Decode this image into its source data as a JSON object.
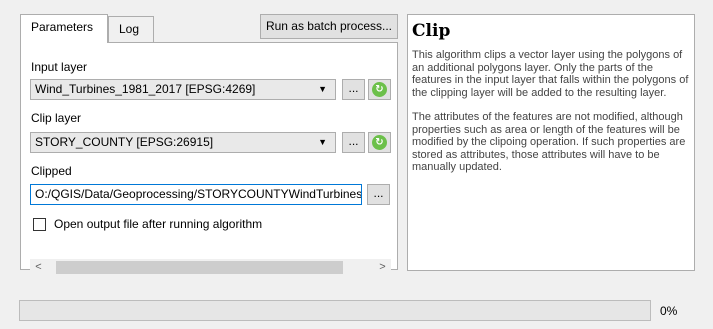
{
  "tabs": [
    {
      "label": "Parameters",
      "active": true
    },
    {
      "label": "Log",
      "active": false
    }
  ],
  "batch_button": "Run as batch process...",
  "params": {
    "input_layer": {
      "label": "Input layer",
      "value": "Wind_Turbines_1981_2017 [EPSG:4269]"
    },
    "clip_layer": {
      "label": "Clip layer",
      "value": "STORY_COUNTY [EPSG:26915]"
    },
    "clipped": {
      "label": "Clipped",
      "value": "O:/QGIS/Data/Geoprocessing/STORYCOUNTYWindTurbines.shp"
    },
    "open_output_label": "Open output file after running algorithm",
    "open_output_checked": false
  },
  "dots_label": "...",
  "help": {
    "title": "Clip",
    "para1": "This algorithm clips a vector layer using the polygons of an additional polygons layer. Only the parts of the features in the input layer that falls within the polygons of the clipping layer will be added to the resulting layer.",
    "para2": "The attributes of the features are not modified, although properties such as area or length of the features will be modified by the clipoing operation. If such properties are stored as attributes, those attributes will have to be manually updated."
  },
  "progress": {
    "value": 0,
    "label": "0%"
  },
  "colors": {
    "accent": "#0078d7",
    "iterate": "#6cc04a"
  }
}
